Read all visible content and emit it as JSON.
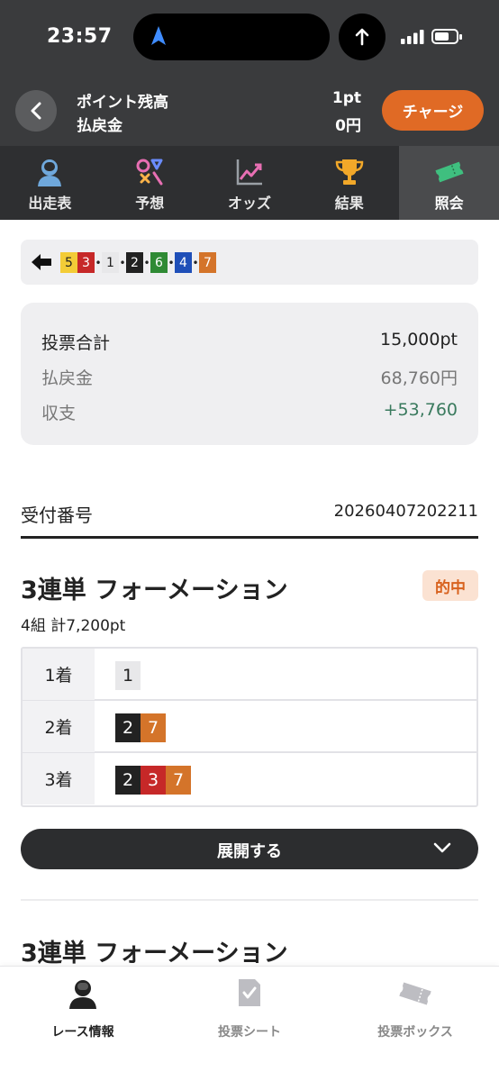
{
  "status": {
    "time": "23:57"
  },
  "header": {
    "points_label": "ポイント残高",
    "points_value": "1pt",
    "payout_label": "払戻金",
    "payout_value": "0円",
    "charge_label": "チャージ"
  },
  "tabs": [
    {
      "label": "出走表",
      "icon": "racer-icon"
    },
    {
      "label": "予想",
      "icon": "prediction-icon"
    },
    {
      "label": "オッズ",
      "icon": "odds-chart-icon"
    },
    {
      "label": "結果",
      "icon": "trophy-icon"
    },
    {
      "label": "照会",
      "icon": "ticket-icon",
      "active": true
    }
  ],
  "result_order": [
    "5",
    "3",
    "1",
    "2",
    "6",
    "4",
    "7"
  ],
  "summary": {
    "total_label": "投票合計",
    "total_value": "15,000pt",
    "payout_label": "払戻金",
    "payout_value": "68,760円",
    "balance_label": "収支",
    "balance_value": "+53,760"
  },
  "receipt": {
    "label": "受付番号",
    "value": "20260407202211"
  },
  "bet": {
    "title": "3連単 フォーメーション",
    "badge": "的中",
    "subtitle": "4組 計7,200pt",
    "rows": [
      {
        "label": "1着",
        "boats": [
          "1"
        ]
      },
      {
        "label": "2着",
        "boats": [
          "2",
          "7"
        ]
      },
      {
        "label": "3着",
        "boats": [
          "2",
          "3",
          "7"
        ]
      }
    ],
    "expand_label": "展開する"
  },
  "bet2": {
    "title": "3連単 フォーメーション"
  },
  "bottom_nav": [
    {
      "label": "レース情報",
      "icon": "racer-info-icon",
      "active": true
    },
    {
      "label": "投票シート",
      "icon": "vote-sheet-icon"
    },
    {
      "label": "投票ボックス",
      "icon": "vote-box-icon"
    }
  ],
  "colors": {
    "accent": "#e06a25",
    "boat_1": "#e8e8ea",
    "boat_2": "#222222",
    "boat_3": "#c62828",
    "boat_4": "#1f4fb8",
    "boat_5": "#f3cc37",
    "boat_6": "#2f8a34",
    "boat_7": "#d4742a",
    "positive": "#3a7a5e"
  }
}
